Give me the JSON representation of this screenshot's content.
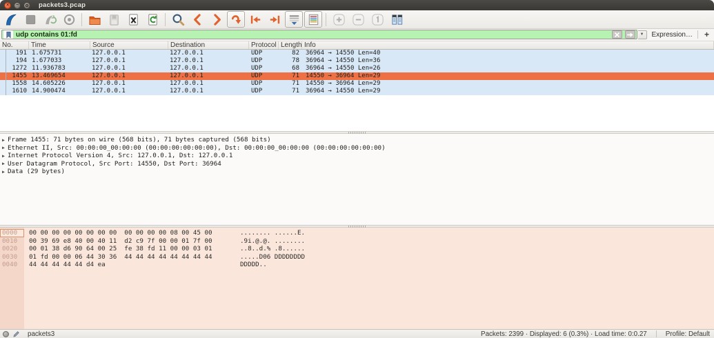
{
  "window": {
    "title": "packets3.pcap"
  },
  "toolbar": {
    "items": [
      {
        "name": "start-capture",
        "state": "enabled"
      },
      {
        "name": "stop-capture",
        "state": "disabled"
      },
      {
        "name": "restart-capture",
        "state": "disabled"
      },
      {
        "name": "capture-options",
        "state": "disabled"
      },
      {
        "name": "separator"
      },
      {
        "name": "open-file",
        "state": "enabled"
      },
      {
        "name": "save-file",
        "state": "disabled"
      },
      {
        "name": "close-file",
        "state": "enabled"
      },
      {
        "name": "reload-file",
        "state": "enabled"
      },
      {
        "name": "separator"
      },
      {
        "name": "find-packet",
        "state": "enabled"
      },
      {
        "name": "go-previous",
        "state": "enabled"
      },
      {
        "name": "go-next",
        "state": "enabled"
      },
      {
        "name": "go-to-packet",
        "state": "active"
      },
      {
        "name": "go-first",
        "state": "enabled"
      },
      {
        "name": "go-last",
        "state": "enabled"
      },
      {
        "name": "auto-scroll",
        "state": "active"
      },
      {
        "name": "colorize",
        "state": "active"
      },
      {
        "name": "separator"
      },
      {
        "name": "zoom-in",
        "state": "disabled"
      },
      {
        "name": "zoom-out",
        "state": "disabled"
      },
      {
        "name": "zoom-100",
        "state": "disabled"
      },
      {
        "name": "resize-columns",
        "state": "enabled"
      }
    ]
  },
  "filter": {
    "value": "udp contains 01:fd",
    "expression_label": "Expression…",
    "add_label": "+"
  },
  "packet_list": {
    "columns": [
      "No.",
      "Time",
      "Source",
      "Destination",
      "Protocol",
      "Length",
      "Info"
    ],
    "selected_no": "1455",
    "rows": [
      {
        "no": "191",
        "time": "1.675731",
        "source": "127.0.0.1",
        "destination": "127.0.0.1",
        "protocol": "UDP",
        "length": "82",
        "info": "36964 → 14550 Len=40"
      },
      {
        "no": "194",
        "time": "1.677033",
        "source": "127.0.0.1",
        "destination": "127.0.0.1",
        "protocol": "UDP",
        "length": "78",
        "info": "36964 → 14550 Len=36"
      },
      {
        "no": "1272",
        "time": "11.936783",
        "source": "127.0.0.1",
        "destination": "127.0.0.1",
        "protocol": "UDP",
        "length": "68",
        "info": "36964 → 14550 Len=26"
      },
      {
        "no": "1455",
        "time": "13.469654",
        "source": "127.0.0.1",
        "destination": "127.0.0.1",
        "protocol": "UDP",
        "length": "71",
        "info": "14550 → 36964 Len=29"
      },
      {
        "no": "1558",
        "time": "14.605226",
        "source": "127.0.0.1",
        "destination": "127.0.0.1",
        "protocol": "UDP",
        "length": "71",
        "info": "14550 → 36964 Len=29"
      },
      {
        "no": "1610",
        "time": "14.900474",
        "source": "127.0.0.1",
        "destination": "127.0.0.1",
        "protocol": "UDP",
        "length": "71",
        "info": "36964 → 14550 Len=29"
      }
    ]
  },
  "details": {
    "lines": [
      "Frame 1455: 71 bytes on wire (568 bits), 71 bytes captured (568 bits)",
      "Ethernet II, Src: 00:00:00_00:00:00 (00:00:00:00:00:00), Dst: 00:00:00_00:00:00 (00:00:00:00:00:00)",
      "Internet Protocol Version 4, Src: 127.0.0.1, Dst: 127.0.0.1",
      "User Datagram Protocol, Src Port: 14550, Dst Port: 36964",
      "Data (29 bytes)"
    ]
  },
  "hex_dump": {
    "rows": [
      {
        "offset": "0000",
        "hex": "00 00 00 00 00 00 00 00  00 00 00 00 08 00 45 00",
        "ascii": "........ ......E."
      },
      {
        "offset": "0010",
        "hex": "00 39 69 e8 40 00 40 11  d2 c9 7f 00 00 01 7f 00",
        "ascii": ".9i.@.@. ........"
      },
      {
        "offset": "0020",
        "hex": "00 01 38 d6 90 64 00 25  fe 38 fd 11 00 00 03 01",
        "ascii": "..8..d.% .8......"
      },
      {
        "offset": "0030",
        "hex": "01 fd 00 00 06 44 30 36  44 44 44 44 44 44 44 44",
        "ascii": ".....D06 DDDDDDDD"
      },
      {
        "offset": "0040",
        "hex": "44 44 44 44 44 d4 ea",
        "ascii": "DDDDD.."
      }
    ]
  },
  "status_bar": {
    "file_name": "packets3",
    "stats": "Packets: 2399 · Displayed: 6 (0.3%) · Load time: 0:0.27",
    "profile": "Profile: Default"
  },
  "colors": {
    "selected_row": "#ed7145",
    "udp_row": "#d9e8f7",
    "filter_valid_bg": "#b7f2b2",
    "hex_pane_bg": "#fbe6db",
    "accent_orange": "#e0622d",
    "wireshark_blue": "#2268ae",
    "titlebar_bg": "#3a3834"
  }
}
